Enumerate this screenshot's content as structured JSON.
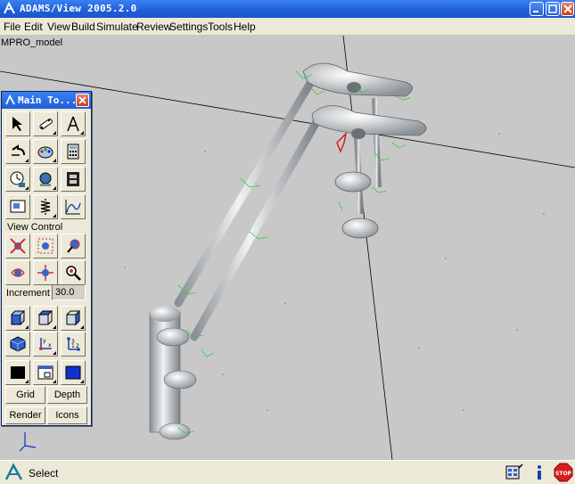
{
  "window": {
    "title": "ADAMS/View 2005.2.0"
  },
  "menu": [
    "File",
    "Edit",
    "View",
    "Build",
    "Simulate",
    "Review",
    "Settings",
    "Tools",
    "Help"
  ],
  "viewport": {
    "model_name": "MPRO_model",
    "background": "#c8c8c8",
    "geometry_color": "#d8dde0",
    "marker_color": "#22cc22"
  },
  "toolbox": {
    "title": "Main To...",
    "tools": [
      "select-arrow-icon",
      "link-icon",
      "compass-icon",
      "undo-icon",
      "colors-icon",
      "calculator-icon",
      "simulate-icon",
      "view-result-icon",
      "animation-icon",
      "plot-icon",
      "spring-icon",
      "curve-plot-icon"
    ],
    "view_control_label": "View Control",
    "view_tools": [
      "rotate-icon",
      "zoom-box-icon",
      "light-icon",
      "rotate-3d-icon",
      "translate-icon",
      "magnify-icon"
    ],
    "increment_label": "Increment",
    "increment_value": "30.0",
    "render_tools": [
      "front-view-icon",
      "top-view-icon",
      "side-view-icon",
      "iso-view-icon",
      "triad-icon",
      "coordinates-icon"
    ],
    "display_tools": [
      "solid-fill-icon",
      "viewport-layout-icon",
      "background-color-icon"
    ],
    "grid_label": "Grid",
    "depth_label": "Depth",
    "render_label": "Render",
    "icons_label": "Icons"
  },
  "status": {
    "text": "Select"
  }
}
